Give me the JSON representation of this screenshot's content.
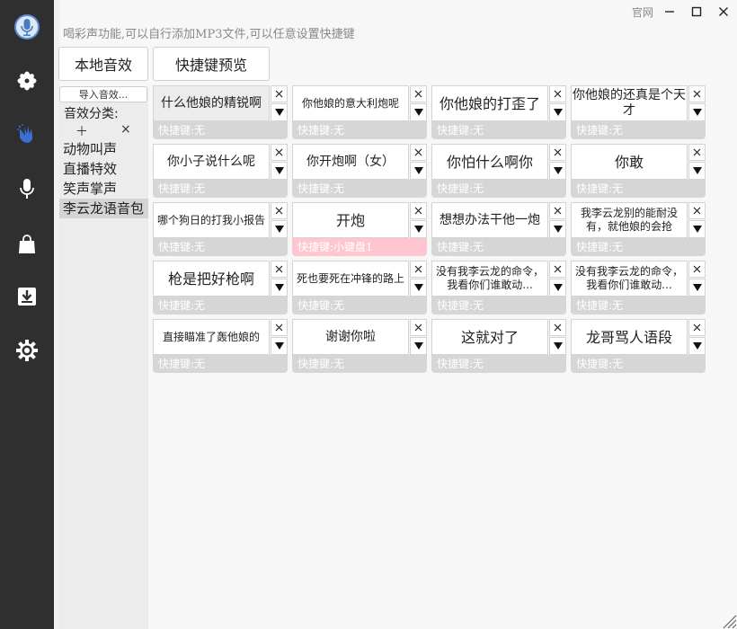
{
  "window": {
    "link": "官网",
    "hint": "喝彩声功能,可以自行添加MP3文件,可以任意设置快捷键"
  },
  "sidebar": {
    "items": [
      {
        "icon": "microphone-logo-icon"
      },
      {
        "icon": "flower-icon"
      },
      {
        "icon": "clap-hands-icon",
        "active": true
      },
      {
        "icon": "microphone-icon"
      },
      {
        "icon": "shopping-bag-icon"
      },
      {
        "icon": "download-icon"
      },
      {
        "icon": "gear-icon"
      }
    ]
  },
  "toolbar": {
    "local_label": "本地音效",
    "preview_label": "快捷键预览"
  },
  "categories": {
    "import_label": "导入音效...",
    "title": "音效分类:",
    "add_label": "＋",
    "delete_label": "×",
    "items": [
      "动物叫声",
      "直播特效",
      "笑声掌声",
      "李云龙语音包"
    ],
    "active_index": 3
  },
  "accent": "#ffc6cf",
  "sounds": [
    {
      "title": "什么他娘的精锐啊",
      "key": "快捷键:无"
    },
    {
      "title": "你他娘的意大利炮呢",
      "key": "快捷键:无"
    },
    {
      "title": "你他娘的打歪了",
      "key": "快捷键:无"
    },
    {
      "title": "你他娘的还真是个天才",
      "key": "快捷键:无"
    },
    {
      "title": "你小子说什么呢",
      "key": "快捷键:无"
    },
    {
      "title": "你开炮啊（女）",
      "key": "快捷键:无"
    },
    {
      "title": "你怕什么啊你",
      "key": "快捷键:无"
    },
    {
      "title": "你敢",
      "key": "快捷键:无"
    },
    {
      "title": "哪个狗日的打我小报告",
      "key": "快捷键:无"
    },
    {
      "title": "开炮",
      "key": "快捷键:小键盘1"
    },
    {
      "title": "想想办法干他一炮",
      "key": "快捷键:无"
    },
    {
      "title": "我李云龙别的能耐没有，就他娘的会抢",
      "key": "快捷键:无"
    },
    {
      "title": "枪是把好枪啊",
      "key": "快捷键:无"
    },
    {
      "title": "死也要死在冲锋的路上",
      "key": "快捷键:无"
    },
    {
      "title": "没有我李云龙的命令，我看你们谁敢动...",
      "key": "快捷键:无"
    },
    {
      "title": "没有我李云龙的命令，我看你们谁敢动...",
      "key": "快捷键:无"
    },
    {
      "title": "直接瞄准了轰他娘的",
      "key": "快捷键:无"
    },
    {
      "title": "谢谢你啦",
      "key": "快捷键:无"
    },
    {
      "title": "这就对了",
      "key": "快捷键:无"
    },
    {
      "title": "龙哥骂人语段",
      "key": "快捷键:无"
    }
  ]
}
